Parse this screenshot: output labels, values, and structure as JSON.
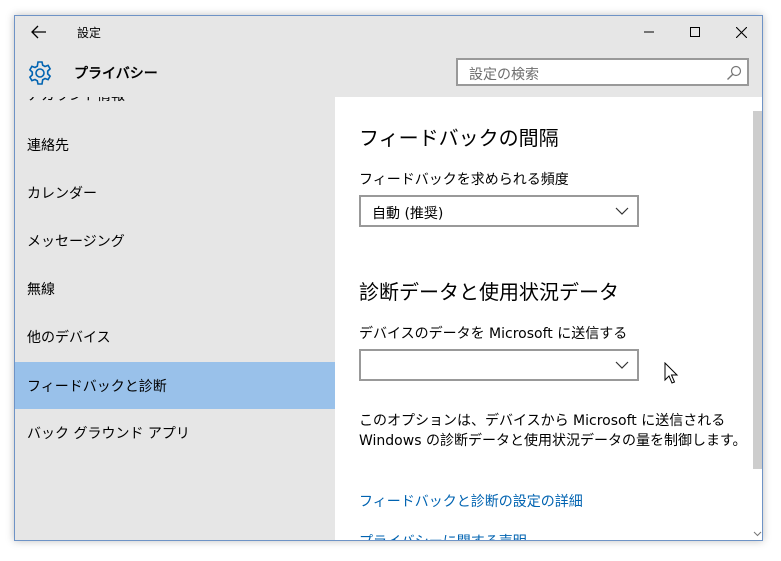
{
  "window": {
    "title": "設定",
    "page_title": "プライバシー"
  },
  "search": {
    "placeholder": "設定の検索"
  },
  "sidebar": {
    "items": [
      {
        "label": "アカウント情報"
      },
      {
        "label": "連絡先"
      },
      {
        "label": "カレンダー"
      },
      {
        "label": "メッセージング"
      },
      {
        "label": "無線"
      },
      {
        "label": "他のデバイス"
      },
      {
        "label": "フィードバックと診断",
        "selected": true
      },
      {
        "label": "バック グラウンド アプリ"
      }
    ]
  },
  "content": {
    "feedback_heading": "フィードバックの間隔",
    "feedback_label": "フィードバックを求められる頻度",
    "feedback_value": "自動 (推奨)",
    "diag_heading": "診断データと使用状況データ",
    "diag_label": "デバイスのデータを Microsoft に送信する",
    "diag_value": "",
    "desc_line1": "このオプションは、デバイスから Microsoft に送信される",
    "desc_line2": "Windows の診断データと使用状況データの量を制御します。",
    "link_details": "フィードバックと診断の設定の詳細",
    "link_privacy": "プライバシーに関する声明"
  },
  "colors": {
    "selected": "#99c1ea",
    "link": "#0063b1",
    "accent": "#0063b1",
    "border": "#6e93c6"
  }
}
